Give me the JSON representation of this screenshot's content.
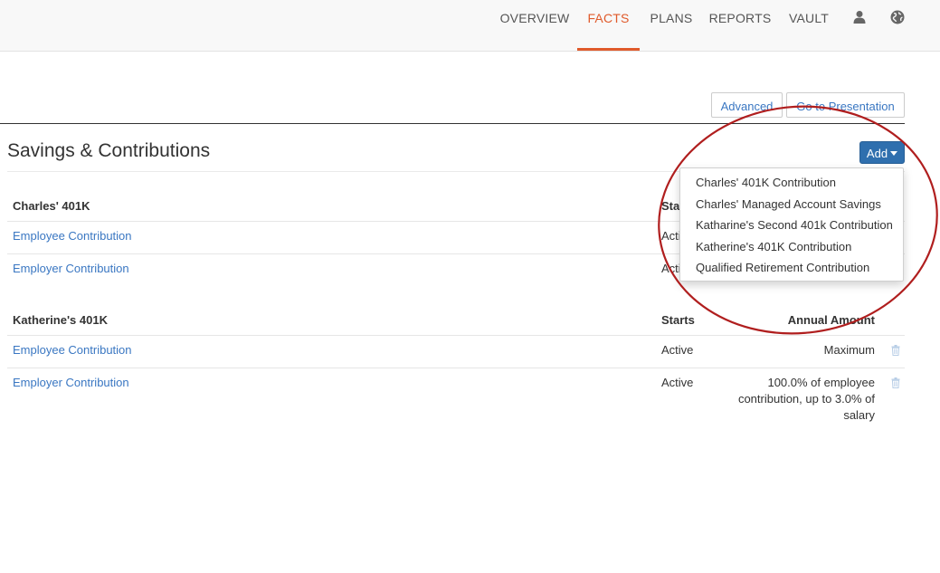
{
  "nav": {
    "items": [
      {
        "label": "OVERVIEW",
        "active": false
      },
      {
        "label": "FACTS",
        "active": true
      },
      {
        "label": "PLANS",
        "active": false
      },
      {
        "label": "REPORTS",
        "active": false
      },
      {
        "label": "VAULT",
        "active": false
      }
    ],
    "icons": [
      "user-icon",
      "globe-icon"
    ],
    "active_color": "#e05a2b"
  },
  "actions": {
    "advanced_label": "Advanced",
    "presentation_label": "Go to Presentation"
  },
  "section": {
    "title": "Savings & Contributions",
    "add_label": "Add"
  },
  "add_menu": {
    "items": [
      "Charles' 401K Contribution",
      "Charles' Managed Account Savings",
      "Katharine's Second 401k Contribution",
      "Katherine's 401K Contribution",
      "Qualified Retirement Contribution"
    ]
  },
  "groups": [
    {
      "title": "Charles' 401K",
      "starts_header": "Starts",
      "amount_header": "",
      "rows": [
        {
          "name": "Employee Contribution",
          "starts": "Active",
          "amount": ""
        },
        {
          "name": "Employer Contribution",
          "starts": "Active",
          "amount": ""
        }
      ]
    },
    {
      "title": "Katherine's 401K",
      "starts_header": "Starts",
      "amount_header": "Annual Amount",
      "rows": [
        {
          "name": "Employee Contribution",
          "starts": "Active",
          "amount": "Maximum"
        },
        {
          "name": "Employer Contribution",
          "starts": "Active",
          "amount": "100.0% of employee contribution, up to 3.0% of salary"
        }
      ]
    }
  ],
  "colors": {
    "link": "#3a77c2",
    "primary_button": "#2f6fae",
    "annotation_circle": "#b01e1e"
  }
}
